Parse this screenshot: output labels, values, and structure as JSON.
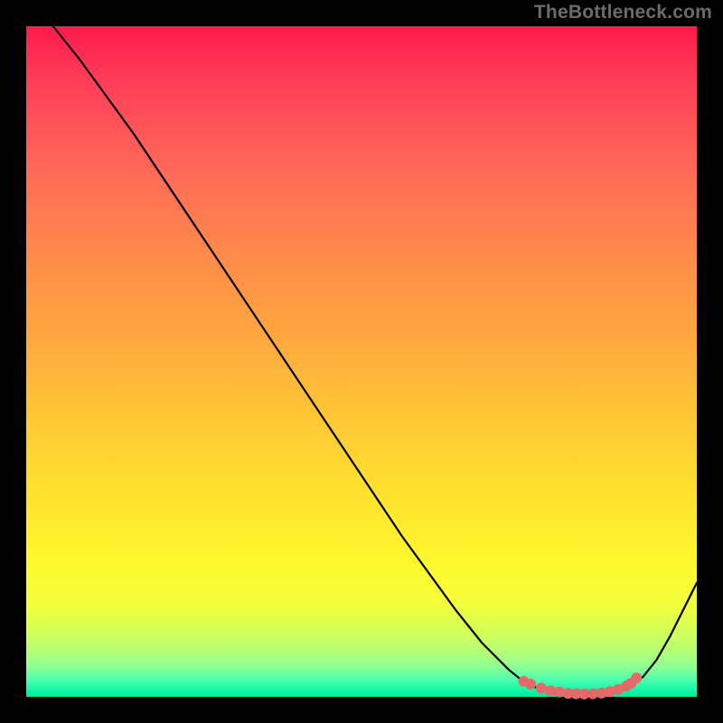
{
  "watermark": "TheBottleneck.com",
  "chart_data": {
    "type": "line",
    "title": "",
    "xlabel": "",
    "ylabel": "",
    "xlim": [
      0,
      100
    ],
    "ylim": [
      0,
      100
    ],
    "series": [
      {
        "name": "bottleneck-curve",
        "x": [
          4,
          8,
          12,
          16,
          20,
          24,
          28,
          32,
          36,
          40,
          44,
          48,
          52,
          56,
          60,
          64,
          68,
          72,
          74,
          76,
          78,
          80,
          82,
          84,
          86,
          88,
          90,
          92,
          94,
          96,
          98,
          100
        ],
        "y": [
          100,
          95,
          89.5,
          84,
          78,
          72,
          66,
          60,
          54,
          48,
          42,
          36,
          30,
          24,
          18.5,
          13,
          8,
          4,
          2.4,
          1.4,
          0.8,
          0.5,
          0.4,
          0.4,
          0.5,
          0.8,
          1.5,
          3,
          5.5,
          9,
          13,
          17
        ]
      },
      {
        "name": "highlight-dots",
        "x": [
          74.2,
          75.2,
          76.8,
          78.2,
          79.5,
          80.8,
          82.0,
          83.2,
          84.5,
          85.8,
          87.0,
          88.3,
          89.5,
          90.2,
          91.0
        ],
        "y": [
          2.3,
          1.9,
          1.3,
          0.9,
          0.7,
          0.5,
          0.45,
          0.42,
          0.45,
          0.55,
          0.75,
          1.1,
          1.6,
          2.0,
          2.8
        ]
      }
    ],
    "colors": {
      "curve": "#000000",
      "dots": "#e46a6a",
      "gradient_top": "#ff1a4d",
      "gradient_bottom": "#00e69a"
    }
  }
}
